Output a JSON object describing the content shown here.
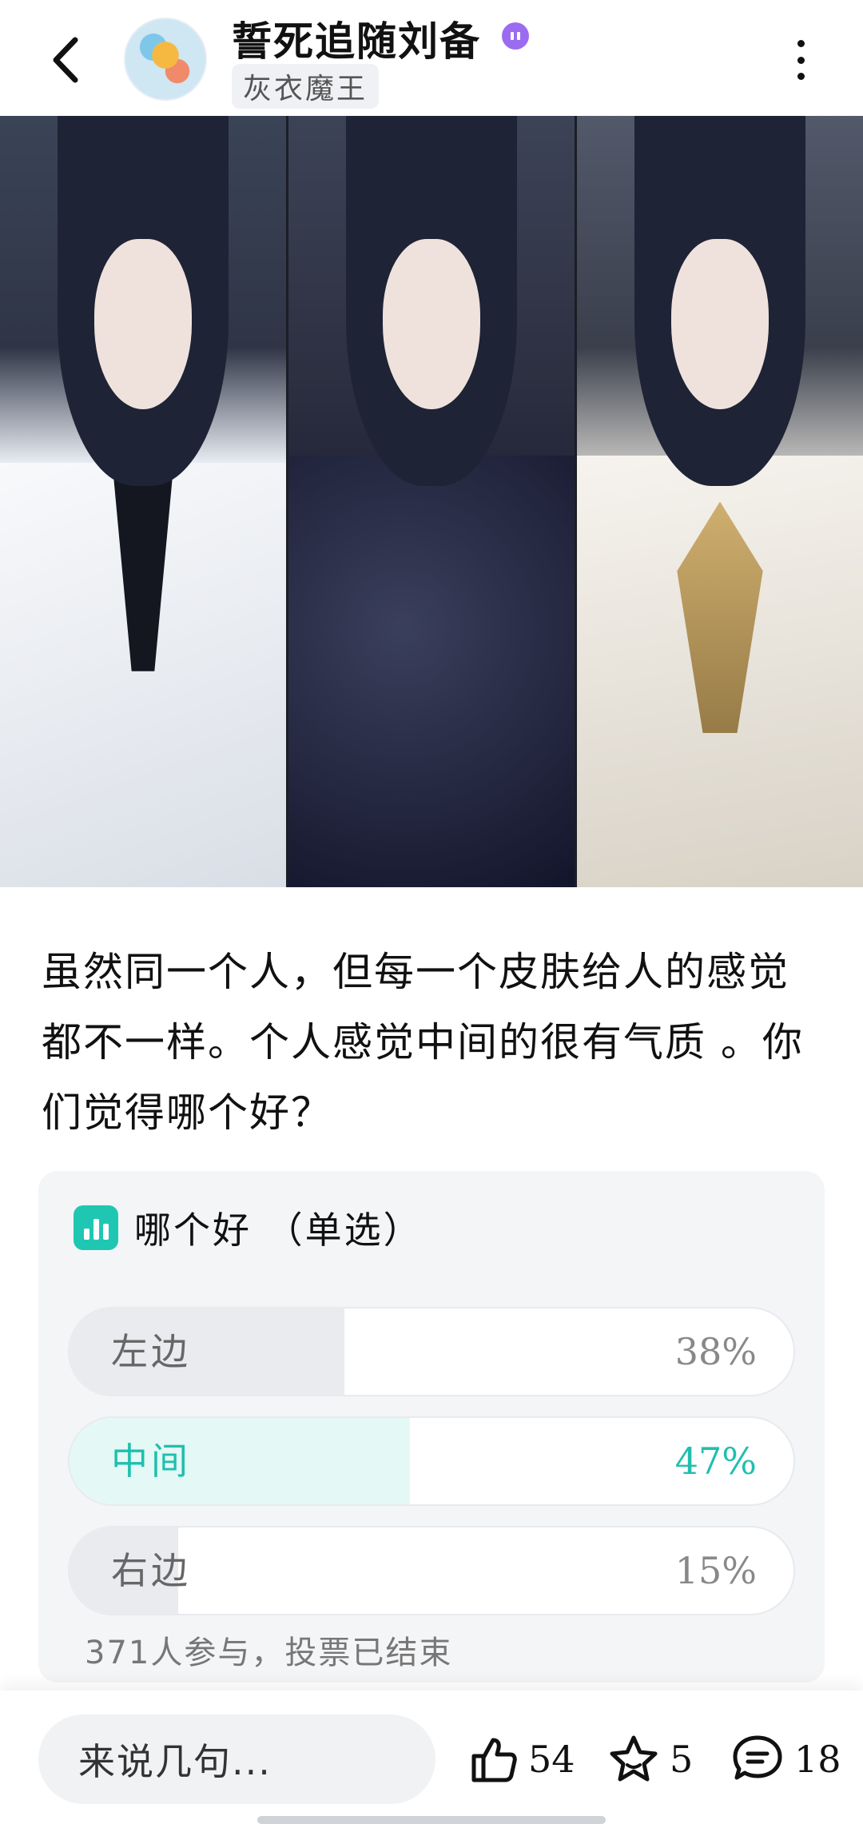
{
  "header": {
    "username": "誓死追随刘备",
    "subtitle": "灰衣魔王",
    "back_icon": "chevron-left-icon",
    "more_icon": "more-vertical-icon",
    "badge_color": "#9b6cf0"
  },
  "post": {
    "text": "虽然同一个人，但每一个皮肤给人的感觉都不一样。个人感觉中间的很有气质 。你们觉得哪个好？"
  },
  "poll": {
    "title": "哪个好 （单选）",
    "accent": "#1fc7b3",
    "options": [
      {
        "label": "左边",
        "percent_text": "38%",
        "percent": 38,
        "selected": false
      },
      {
        "label": "中间",
        "percent_text": "47%",
        "percent": 47,
        "selected": true
      },
      {
        "label": "右边",
        "percent_text": "15%",
        "percent": 15,
        "selected": false
      }
    ],
    "footer": "371人参与，投票已结束"
  },
  "bottom_bar": {
    "comment_placeholder": "来说几句...",
    "likes": "54",
    "favorites": "5",
    "comments": "18"
  }
}
